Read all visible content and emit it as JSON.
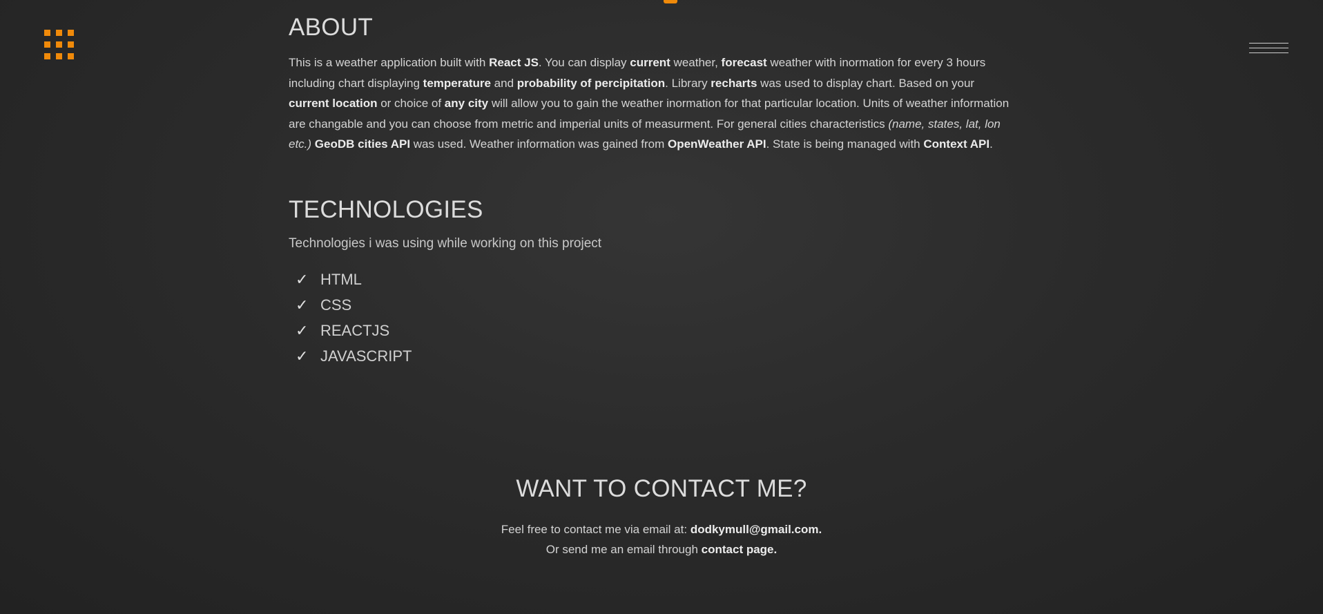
{
  "icons": {
    "grid_menu": "grid-menu-icon",
    "hamburger": "hamburger-menu-icon",
    "check": "check-icon"
  },
  "colors": {
    "accent": "#f08a0a",
    "background": "#2b2b2b",
    "text": "#d4d4d4"
  },
  "about": {
    "title": "ABOUT",
    "segments": [
      {
        "text": "This is a weather application built with ",
        "style": "normal"
      },
      {
        "text": "React JS",
        "style": "bold"
      },
      {
        "text": ". You can display ",
        "style": "normal"
      },
      {
        "text": "current",
        "style": "bold"
      },
      {
        "text": " weather, ",
        "style": "normal"
      },
      {
        "text": "forecast",
        "style": "bold"
      },
      {
        "text": " weather with inormation for every 3 hours including chart displaying ",
        "style": "normal"
      },
      {
        "text": "temperature",
        "style": "bold"
      },
      {
        "text": " and ",
        "style": "normal"
      },
      {
        "text": "probability of percipitation",
        "style": "bold"
      },
      {
        "text": ". Library ",
        "style": "normal"
      },
      {
        "text": "recharts",
        "style": "bold"
      },
      {
        "text": " was used to display chart. Based on your ",
        "style": "normal"
      },
      {
        "text": "current location",
        "style": "bold"
      },
      {
        "text": " or choice of ",
        "style": "normal"
      },
      {
        "text": "any city",
        "style": "bold"
      },
      {
        "text": " will allow you to gain the weather inormation for that particular location. Units of weather information are changable and you can choose from metric and imperial units of measurment. For general cities characteristics ",
        "style": "normal"
      },
      {
        "text": "(name, states, lat, lon etc.)",
        "style": "italic"
      },
      {
        "text": " ",
        "style": "normal"
      },
      {
        "text": "GeoDB cities API",
        "style": "bold"
      },
      {
        "text": " was used. Weather information was gained from ",
        "style": "normal"
      },
      {
        "text": "OpenWeather API",
        "style": "bold"
      },
      {
        "text": ". State is being managed with ",
        "style": "normal"
      },
      {
        "text": "Context API",
        "style": "bold"
      },
      {
        "text": ".",
        "style": "normal"
      }
    ]
  },
  "technologies": {
    "title": "TECHNOLOGIES",
    "subtitle": "Technologies i was using while working on this project",
    "check_glyph": "✓",
    "items": [
      "HTML",
      "CSS",
      "REACTJS",
      "JAVASCRIPT"
    ]
  },
  "contact": {
    "title": "WANT TO CONTACT ME?",
    "line1_prefix": "Feel free to contact me via email at: ",
    "email": "dodkymull@gmail.com.",
    "line2_prefix": "Or send me an email through ",
    "contact_link": "contact page."
  }
}
